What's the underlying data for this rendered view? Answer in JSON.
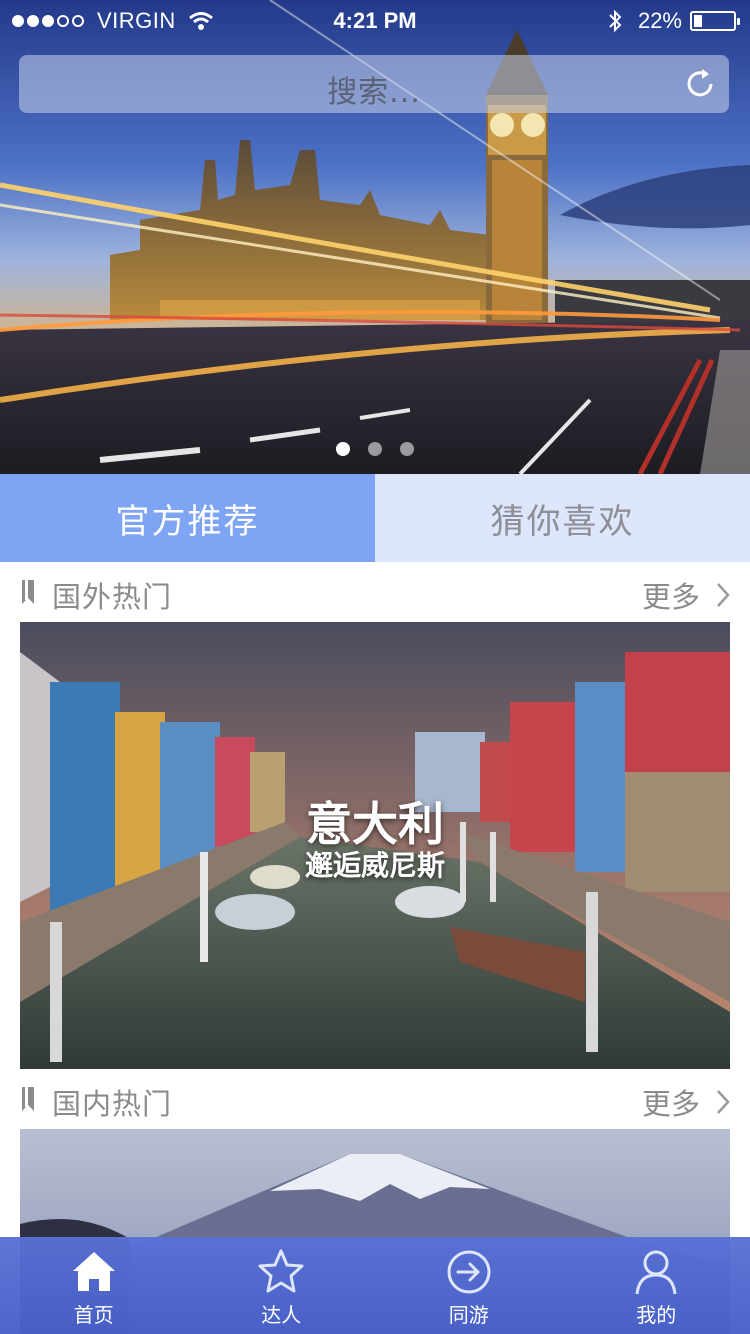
{
  "status_bar": {
    "carrier": "VIRGIN",
    "time": "4:21 PM",
    "battery": "22%",
    "battery_level": 0.22
  },
  "search": {
    "placeholder": "搜索..."
  },
  "hero": {
    "slide_count": 3,
    "active_slide": 1,
    "scene": "London — Big Ben and Houses of Parliament at dusk with light trails"
  },
  "tabs": [
    {
      "label": "官方推荐",
      "active": true
    },
    {
      "label": "猜你喜欢",
      "active": false
    }
  ],
  "sections": [
    {
      "title": "国外热门",
      "more_label": "更多",
      "card": {
        "title": "意大利",
        "subtitle": "邂逅威尼斯"
      }
    },
    {
      "title": "国内热门",
      "more_label": "更多"
    }
  ],
  "tabbar": [
    {
      "label": "首页",
      "icon": "home-icon",
      "active": true
    },
    {
      "label": "达人",
      "icon": "star-icon",
      "active": false
    },
    {
      "label": "同游",
      "icon": "arrow-circle-icon",
      "active": false
    },
    {
      "label": "我的",
      "icon": "user-icon",
      "active": false
    }
  ],
  "colors": {
    "tab_active_bg": "#7da5f4",
    "tab_inactive_bg": "#dde6fb",
    "tabbar_bg": "#5871d6",
    "muted_text": "#8b8b8b"
  }
}
